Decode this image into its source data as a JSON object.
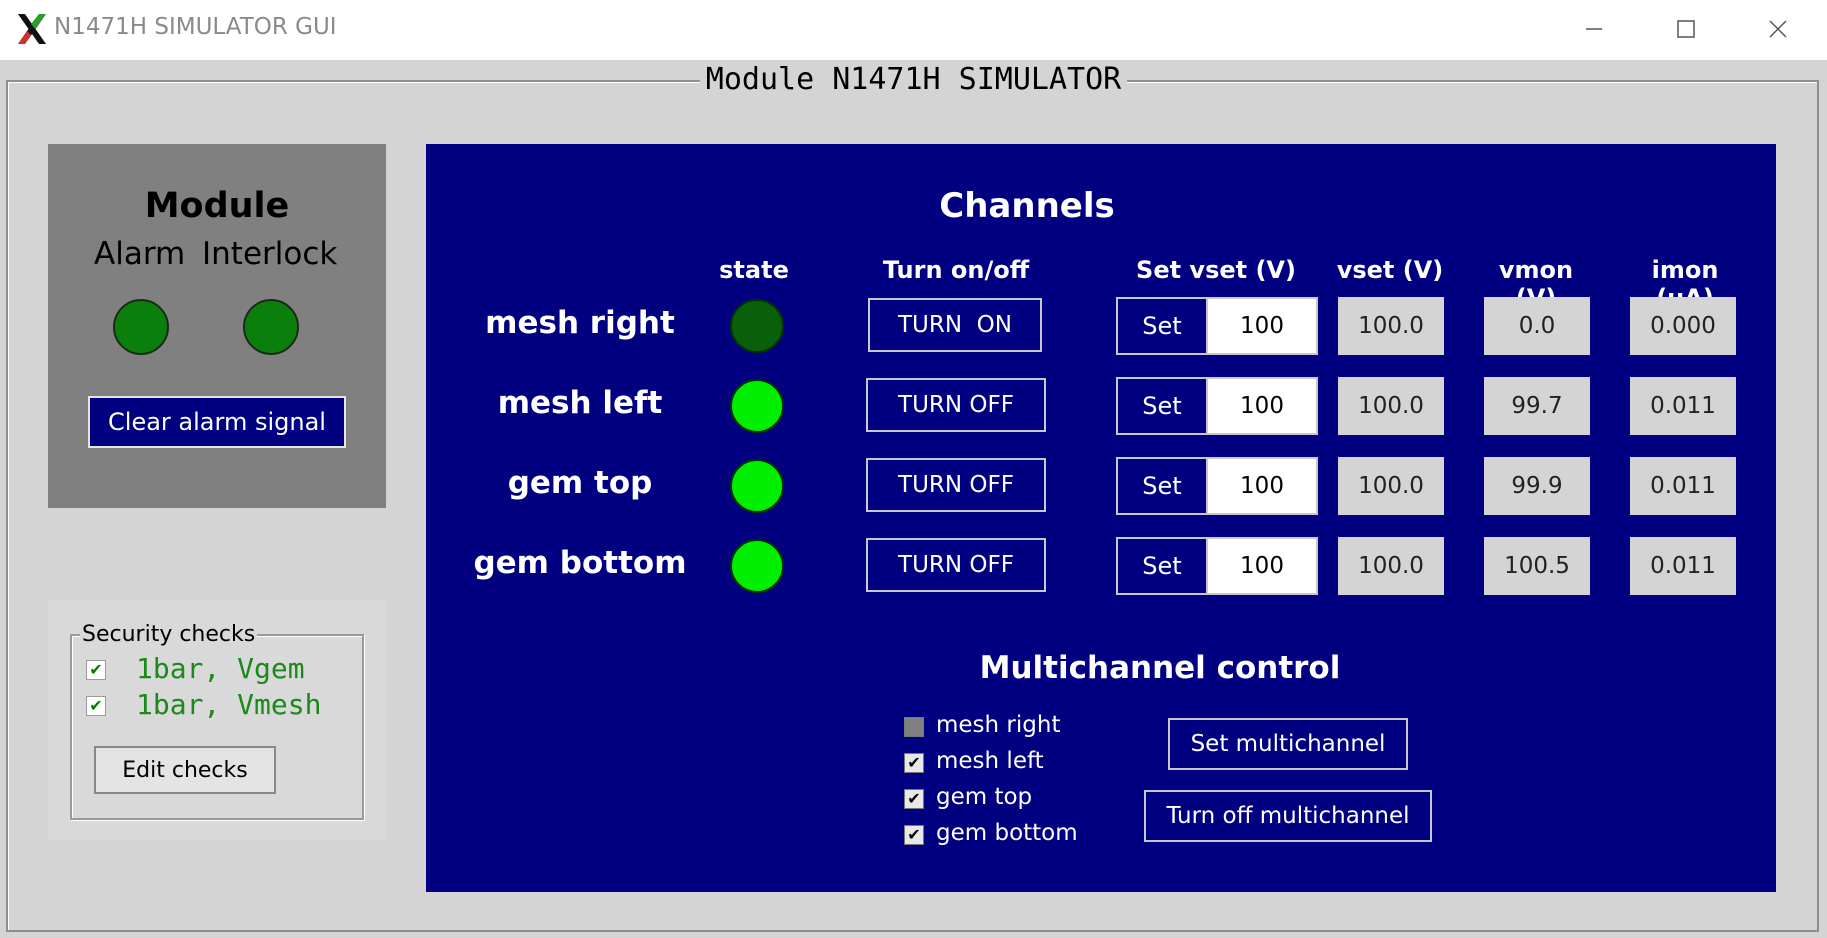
{
  "window": {
    "title": "N1471H SIMULATOR GUI",
    "frame_title": "Module N1471H SIMULATOR"
  },
  "module": {
    "title": "Module",
    "alarm_label": "Alarm",
    "interlock_label": "Interlock",
    "alarm_color": "#0b7f0b",
    "interlock_color": "#0b7f0b",
    "clear_button": "Clear alarm signal"
  },
  "security": {
    "legend": "Security checks",
    "items": [
      {
        "label": "1bar, Vgem",
        "checked": true
      },
      {
        "label": "1bar, Vmesh",
        "checked": true
      }
    ],
    "edit_button": "Edit checks"
  },
  "channels": {
    "title": "Channels",
    "headers": {
      "state": "state",
      "turn": "Turn on/off",
      "set_vset": "Set vset (V)",
      "vset": "vset (V)",
      "vmon": "vmon (V)",
      "imon": "imon (uA)"
    },
    "set_label": "Set",
    "rows": [
      {
        "name": "mesh right",
        "state_color": "#0a5f0a",
        "turn_label": "TURN  ON",
        "set_value": "100",
        "vset": "100.0",
        "vmon": "0.0",
        "imon": "0.000"
      },
      {
        "name": "mesh left",
        "state_color": "#00ee00",
        "turn_label": "TURN OFF",
        "set_value": "100",
        "vset": "100.0",
        "vmon": "99.7",
        "imon": "0.011"
      },
      {
        "name": "gem top",
        "state_color": "#00ee00",
        "turn_label": "TURN OFF",
        "set_value": "100",
        "vset": "100.0",
        "vmon": "99.9",
        "imon": "0.011"
      },
      {
        "name": "gem bottom",
        "state_color": "#00ee00",
        "turn_label": "TURN OFF",
        "set_value": "100",
        "vset": "100.0",
        "vmon": "100.5",
        "imon": "0.011"
      }
    ]
  },
  "multichannel": {
    "title": "Multichannel control",
    "items": [
      {
        "label": "mesh right",
        "checked": false
      },
      {
        "label": "mesh left",
        "checked": true
      },
      {
        "label": "gem top",
        "checked": true
      },
      {
        "label": "gem bottom",
        "checked": true
      }
    ],
    "set_button": "Set multichannel",
    "off_button": "Turn off multichannel"
  },
  "colors": {
    "panel_blue": "#000080",
    "led_on": "#00ee00",
    "led_off": "#0a5f0a"
  }
}
